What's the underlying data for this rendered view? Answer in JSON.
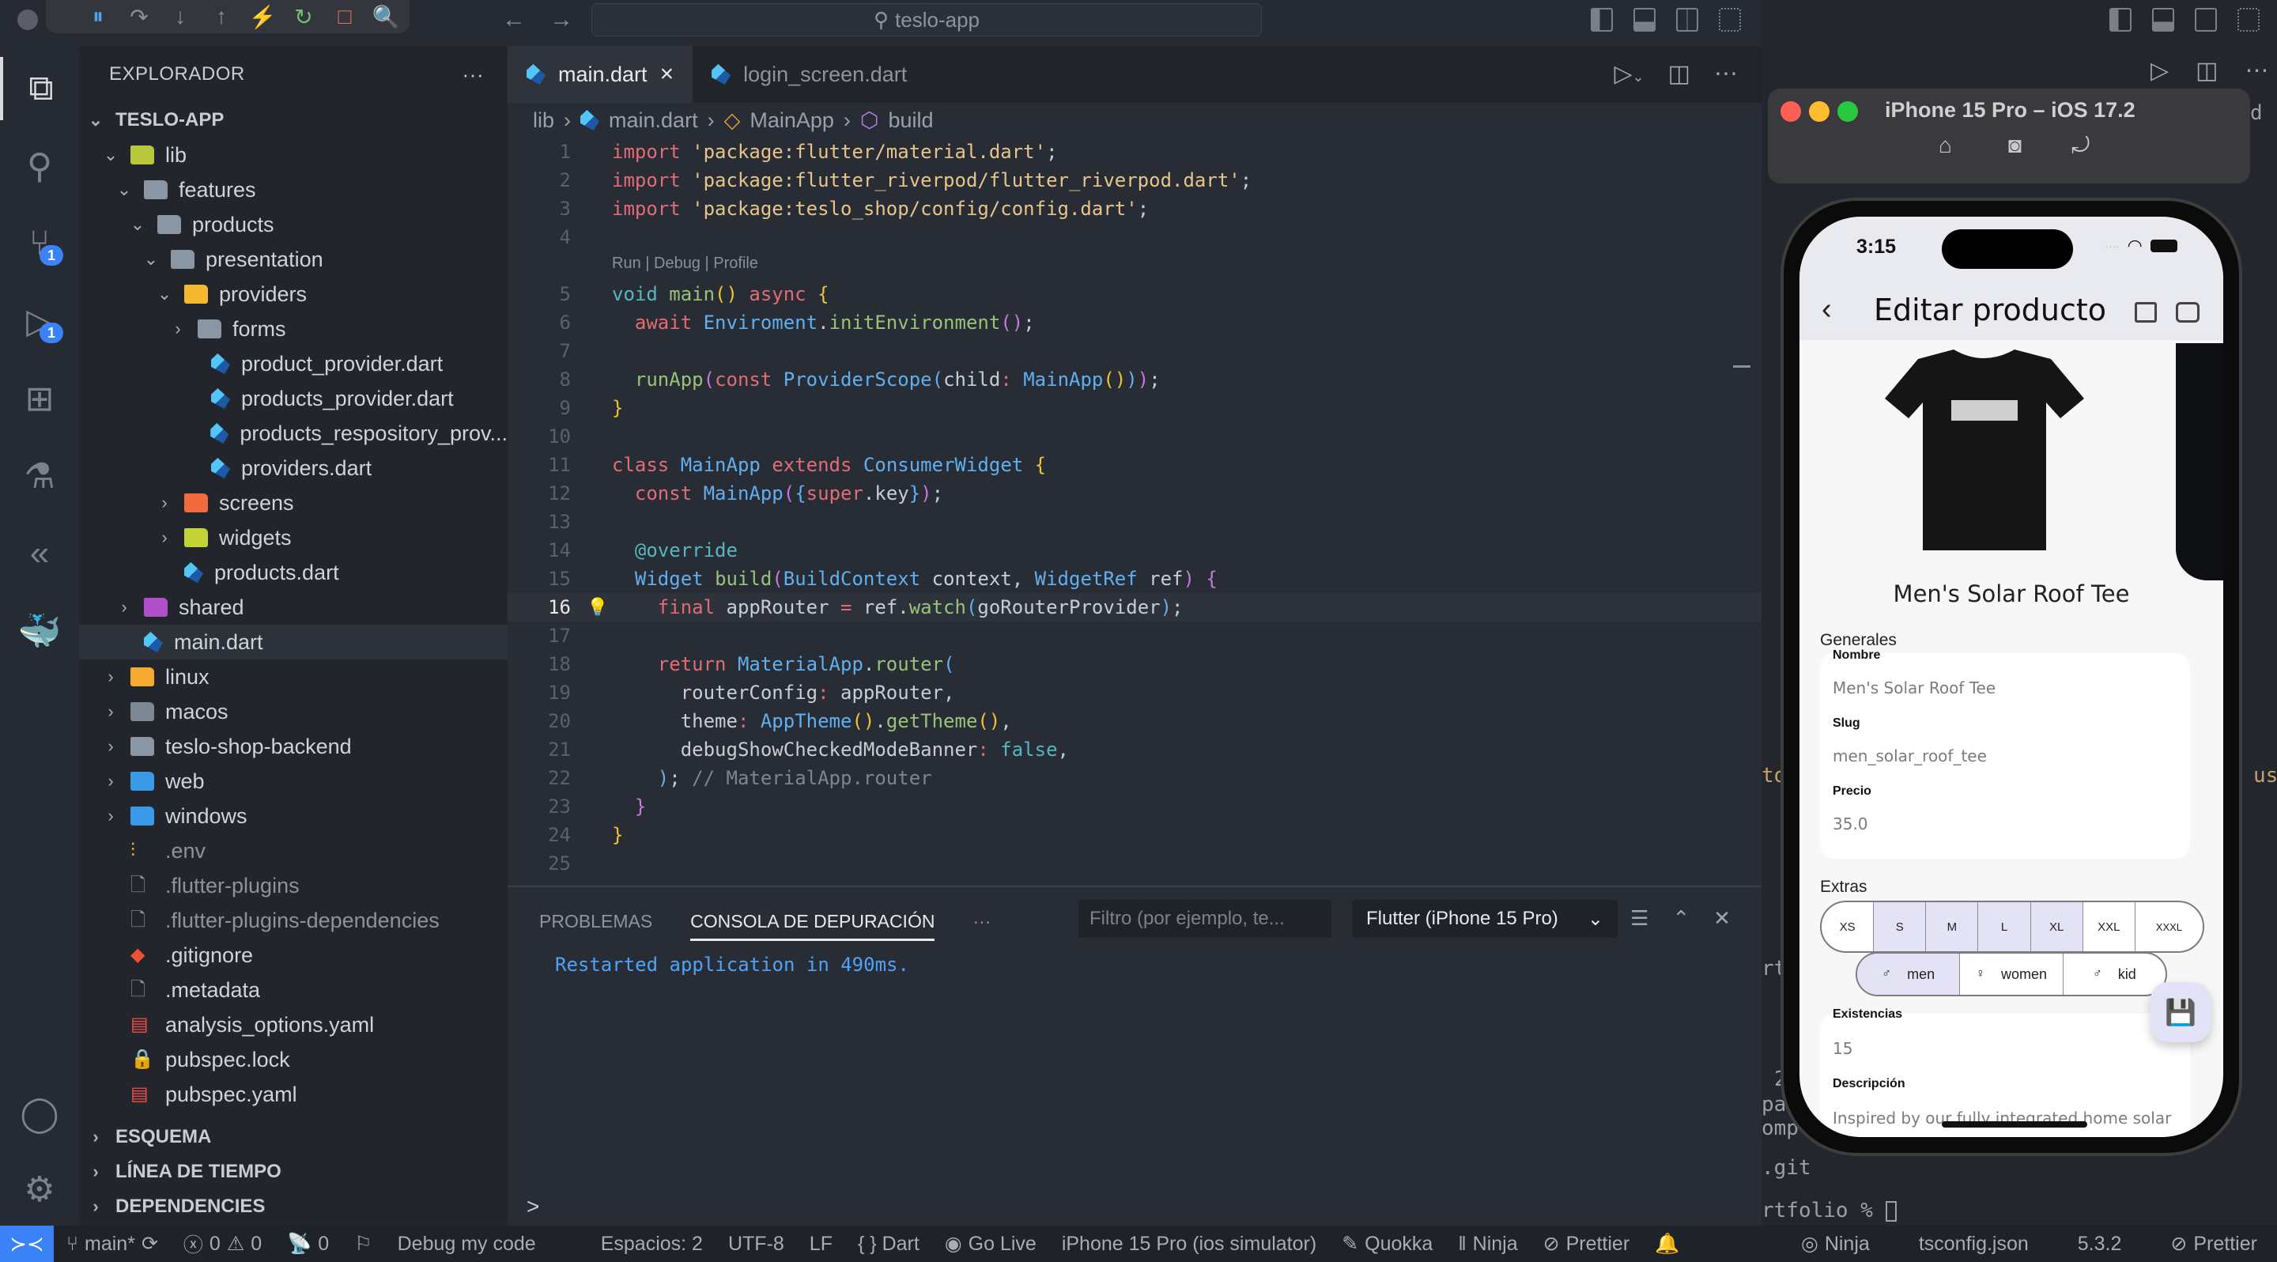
{
  "window": {
    "command_center": "teslo-app",
    "debug_toolbar": [
      {
        "name": "pause-icon",
        "glyph": "⏸",
        "color": "#4fa3f7"
      },
      {
        "name": "step-over-icon",
        "glyph": "↷",
        "color": "#8a8f98"
      },
      {
        "name": "step-into-icon",
        "glyph": "↓",
        "color": "#8a8f98"
      },
      {
        "name": "step-out-icon",
        "glyph": "↑",
        "color": "#8a8f98"
      },
      {
        "name": "hot-reload-icon",
        "glyph": "⚡",
        "color": "#f5a623"
      },
      {
        "name": "restart-icon",
        "glyph": "↻",
        "color": "#6cc46c"
      },
      {
        "name": "stop-icon",
        "glyph": "□",
        "color": "#f06b5b"
      },
      {
        "name": "flutter-inspector-icon",
        "glyph": "🔍",
        "color": "#3ba8e8"
      }
    ]
  },
  "activity_bar": [
    {
      "name": "explorer",
      "glyph": "⧉"
    },
    {
      "name": "search",
      "glyph": "⚲"
    },
    {
      "name": "source-control",
      "glyph": "⑂",
      "badge": "1"
    },
    {
      "name": "run-debug",
      "glyph": "▷",
      "badge": "1"
    },
    {
      "name": "extensions",
      "glyph": "⊞"
    },
    {
      "name": "testing",
      "glyph": "⚗"
    },
    {
      "name": "flutter",
      "glyph": "«"
    },
    {
      "name": "docker",
      "glyph": "🐳"
    }
  ],
  "activity_bottom": [
    {
      "name": "accounts",
      "glyph": "◯"
    },
    {
      "name": "settings",
      "glyph": "⚙"
    }
  ],
  "sidebar": {
    "title": "EXPLORADOR",
    "root": "TESLO-APP",
    "tree": [
      {
        "label": "lib",
        "depth": 1,
        "type": "folder",
        "open": true,
        "color": "#b7c93a"
      },
      {
        "label": "features",
        "depth": 2,
        "type": "folder",
        "open": true,
        "color": "#8a96a3"
      },
      {
        "label": "products",
        "depth": 3,
        "type": "folder",
        "open": true,
        "color": "#8a96a3"
      },
      {
        "label": "presentation",
        "depth": 4,
        "type": "folder",
        "open": true,
        "color": "#8a96a3"
      },
      {
        "label": "providers",
        "depth": 5,
        "type": "folder",
        "open": true,
        "color": "#f4b930"
      },
      {
        "label": "forms",
        "depth": 6,
        "type": "folder",
        "open": false,
        "color": "#8a96a3"
      },
      {
        "label": "product_provider.dart",
        "depth": 7,
        "type": "dart"
      },
      {
        "label": "products_provider.dart",
        "depth": 7,
        "type": "dart"
      },
      {
        "label": "products_respository_prov...",
        "depth": 7,
        "type": "dart"
      },
      {
        "label": "providers.dart",
        "depth": 7,
        "type": "dart"
      },
      {
        "label": "screens",
        "depth": 5,
        "type": "folder",
        "open": false,
        "color": "#f26b3f"
      },
      {
        "label": "widgets",
        "depth": 5,
        "type": "folder",
        "open": false,
        "color": "#c3d237"
      },
      {
        "label": "products.dart",
        "depth": 5,
        "type": "dart",
        "nochev": true
      },
      {
        "label": "shared",
        "depth": 2,
        "type": "folder",
        "open": false,
        "color": "#b04fc9"
      },
      {
        "label": "main.dart",
        "depth": 2,
        "type": "dart",
        "nochev": true,
        "selected": true
      },
      {
        "label": "linux",
        "depth": 1,
        "type": "folder",
        "open": false,
        "color": "#f4a930"
      },
      {
        "label": "macos",
        "depth": 1,
        "type": "folder",
        "open": false,
        "color": "#7d8792"
      },
      {
        "label": "teslo-shop-backend",
        "depth": 1,
        "type": "folder",
        "open": false,
        "color": "#8a96a3"
      },
      {
        "label": "web",
        "depth": 1,
        "type": "folder",
        "open": false,
        "color": "#3b9ae8"
      },
      {
        "label": "windows",
        "depth": 1,
        "type": "folder",
        "open": false,
        "color": "#3b9ae8"
      },
      {
        "label": ".env",
        "depth": 1,
        "type": "env",
        "dim": true
      },
      {
        "label": ".flutter-plugins",
        "depth": 1,
        "type": "file",
        "dim": true
      },
      {
        "label": ".flutter-plugins-dependencies",
        "depth": 1,
        "type": "file",
        "dim": true
      },
      {
        "label": ".gitignore",
        "depth": 1,
        "type": "git"
      },
      {
        "label": ".metadata",
        "depth": 1,
        "type": "file"
      },
      {
        "label": "analysis_options.yaml",
        "depth": 1,
        "type": "yaml"
      },
      {
        "label": "pubspec.lock",
        "depth": 1,
        "type": "lock"
      },
      {
        "label": "pubspec.yaml",
        "depth": 1,
        "type": "yaml"
      }
    ],
    "sections": [
      "ESQUEMA",
      "LÍNEA DE TIEMPO",
      "DEPENDENCIES"
    ]
  },
  "editor": {
    "tabs": [
      {
        "label": "main.dart",
        "active": true,
        "close": "×"
      },
      {
        "label": "login_screen.dart",
        "active": false
      }
    ],
    "breadcrumb": [
      "lib",
      "main.dart",
      "MainApp",
      "build"
    ],
    "codelens": "Run | Debug | Profile",
    "current_line": 16,
    "lines": [
      [
        [
          "k",
          "import"
        ],
        [
          "w",
          " "
        ],
        [
          "s",
          "'package:flutter/material.dart'"
        ],
        [
          "w",
          ";"
        ]
      ],
      [
        [
          "k",
          "import"
        ],
        [
          "w",
          " "
        ],
        [
          "s",
          "'package:flutter_riverpod/flutter_riverpod.dart'"
        ],
        [
          "w",
          ";"
        ]
      ],
      [
        [
          "k",
          "import"
        ],
        [
          "w",
          " "
        ],
        [
          "s",
          "'package:teslo_shop/config/config.dart'"
        ],
        [
          "w",
          ";"
        ]
      ],
      [],
      [
        [
          "cy",
          "void"
        ],
        [
          "w",
          " "
        ],
        [
          "f",
          "main"
        ],
        [
          "y",
          "()"
        ],
        [
          "w",
          " "
        ],
        [
          "k",
          "async"
        ],
        [
          "w",
          " "
        ],
        [
          "y",
          "{"
        ]
      ],
      [
        [
          "w",
          "  "
        ],
        [
          "k",
          "await"
        ],
        [
          "w",
          " "
        ],
        [
          "t",
          "Enviroment"
        ],
        [
          "w",
          "."
        ],
        [
          "f",
          "initEnvironment"
        ],
        [
          "p",
          "()"
        ],
        [
          "w",
          ";"
        ]
      ],
      [],
      [
        [
          "w",
          "  "
        ],
        [
          "f",
          "runApp"
        ],
        [
          "p",
          "("
        ],
        [
          "k",
          "const"
        ],
        [
          "w",
          " "
        ],
        [
          "t",
          "ProviderScope"
        ],
        [
          "t",
          "("
        ],
        [
          "w",
          "child"
        ],
        [
          "k",
          ":"
        ],
        [
          "w",
          " "
        ],
        [
          "t",
          "MainApp"
        ],
        [
          "y",
          "()"
        ],
        [
          "t",
          ")"
        ],
        [
          "p",
          ")"
        ],
        [
          "w",
          ";"
        ]
      ],
      [
        [
          "y",
          "}"
        ]
      ],
      [],
      [
        [
          "k",
          "class"
        ],
        [
          "w",
          " "
        ],
        [
          "t",
          "MainApp"
        ],
        [
          "w",
          " "
        ],
        [
          "k",
          "extends"
        ],
        [
          "w",
          " "
        ],
        [
          "t",
          "ConsumerWidget"
        ],
        [
          "w",
          " "
        ],
        [
          "y",
          "{"
        ]
      ],
      [
        [
          "w",
          "  "
        ],
        [
          "k",
          "const"
        ],
        [
          "w",
          " "
        ],
        [
          "t",
          "MainApp"
        ],
        [
          "p",
          "("
        ],
        [
          "t",
          "{"
        ],
        [
          "k",
          "super"
        ],
        [
          "w",
          ".key"
        ],
        [
          "t",
          "}"
        ],
        [
          "p",
          ")"
        ],
        [
          "w",
          ";"
        ]
      ],
      [],
      [
        [
          "w",
          "  "
        ],
        [
          "cy",
          "@override"
        ]
      ],
      [
        [
          "w",
          "  "
        ],
        [
          "t",
          "Widget"
        ],
        [
          "w",
          " "
        ],
        [
          "f",
          "build"
        ],
        [
          "p",
          "("
        ],
        [
          "t",
          "BuildContext"
        ],
        [
          "w",
          " context, "
        ],
        [
          "t",
          "WidgetRef"
        ],
        [
          "w",
          " ref"
        ],
        [
          "p",
          ")"
        ],
        [
          "w",
          " "
        ],
        [
          "p",
          "{"
        ]
      ],
      [
        [
          "w",
          "    "
        ],
        [
          "k",
          "final"
        ],
        [
          "w",
          " appRouter "
        ],
        [
          "k",
          "="
        ],
        [
          "w",
          " ref."
        ],
        [
          "f",
          "watch"
        ],
        [
          "t",
          "("
        ],
        [
          "w",
          "goRouterProvider"
        ],
        [
          "t",
          ")"
        ],
        [
          "w",
          ";"
        ]
      ],
      [],
      [
        [
          "w",
          "    "
        ],
        [
          "k",
          "return"
        ],
        [
          "w",
          " "
        ],
        [
          "t",
          "MaterialApp"
        ],
        [
          "w",
          "."
        ],
        [
          "f",
          "router"
        ],
        [
          "t",
          "("
        ]
      ],
      [
        [
          "w",
          "      routerConfig"
        ],
        [
          "k",
          ":"
        ],
        [
          "w",
          " appRouter,"
        ]
      ],
      [
        [
          "w",
          "      theme"
        ],
        [
          "k",
          ":"
        ],
        [
          "w",
          " "
        ],
        [
          "t",
          "AppTheme"
        ],
        [
          "y",
          "()"
        ],
        [
          "w",
          "."
        ],
        [
          "f",
          "getTheme"
        ],
        [
          "y",
          "()"
        ],
        [
          "w",
          ","
        ]
      ],
      [
        [
          "w",
          "      debugShowCheckedModeBanner"
        ],
        [
          "k",
          ":"
        ],
        [
          "w",
          " "
        ],
        [
          "cy",
          "false"
        ],
        [
          "w",
          ","
        ]
      ],
      [
        [
          "w",
          "    "
        ],
        [
          "t",
          ")"
        ],
        [
          "w",
          "; "
        ],
        [
          "c",
          "// MaterialApp.router"
        ]
      ],
      [
        [
          "w",
          "  "
        ],
        [
          "p",
          "}"
        ]
      ],
      [
        [
          "y",
          "}"
        ]
      ],
      []
    ]
  },
  "panel": {
    "tabs": [
      "PROBLEMAS",
      "CONSOLA DE DEPURACIÓN"
    ],
    "active_tab": 1,
    "more": "···",
    "filter_placeholder": "Filtro (por ejemplo, te...",
    "session": "Flutter (iPhone 15 Pro)",
    "output": "Restarted application in 490ms.",
    "prompt": ">"
  },
  "statusbar": {
    "branch": "main*",
    "errors": "0",
    "warnings": "0",
    "ports": "0",
    "debug_label": "Debug my code",
    "items": [
      "Espacios: 2",
      "UTF-8",
      "LF",
      "{ } Dart",
      "Go Live",
      "iPhone 15 Pro (ios simulator)",
      "Quokka",
      "Ninja",
      "Prettier"
    ],
    "right_items": [
      "Ninja",
      "tsconfig.json",
      "5.3.2",
      "Prettier"
    ]
  },
  "terminal_peek": {
    "lines": [
      ".git",
      "rtfolio % "
    ],
    "fragments": [
      "d",
      "to",
      "us",
      "rt",
      "2",
      "pa",
      "omp"
    ]
  },
  "simulator": {
    "title": "iPhone 15 Pro – iOS 17.2",
    "time": "3:15",
    "app": {
      "title": "Editar producto",
      "product_name": "Men's Solar Roof Tee",
      "section_general": "Generales",
      "fields": [
        {
          "label": "Nombre",
          "value": "Men's Solar Roof Tee"
        },
        {
          "label": "Slug",
          "value": "men_solar_roof_tee"
        },
        {
          "label": "Precio",
          "value": "35.0"
        }
      ],
      "section_extras": "Extras",
      "sizes": [
        {
          "label": "XS",
          "selected": false
        },
        {
          "label": "S",
          "selected": true
        },
        {
          "label": "M",
          "selected": true
        },
        {
          "label": "L",
          "selected": true
        },
        {
          "label": "XL",
          "selected": true
        },
        {
          "label": "XXL",
          "selected": false
        },
        {
          "label": "XXXL",
          "selected": false
        }
      ],
      "genders": [
        {
          "label": "men",
          "selected": true
        },
        {
          "label": "women",
          "selected": false
        },
        {
          "label": "kid",
          "selected": false
        }
      ],
      "stock_label": "Existencias",
      "stock_value": "15",
      "description_label": "Descripción",
      "description_value": "Inspired by our fully integrated home solar"
    }
  }
}
